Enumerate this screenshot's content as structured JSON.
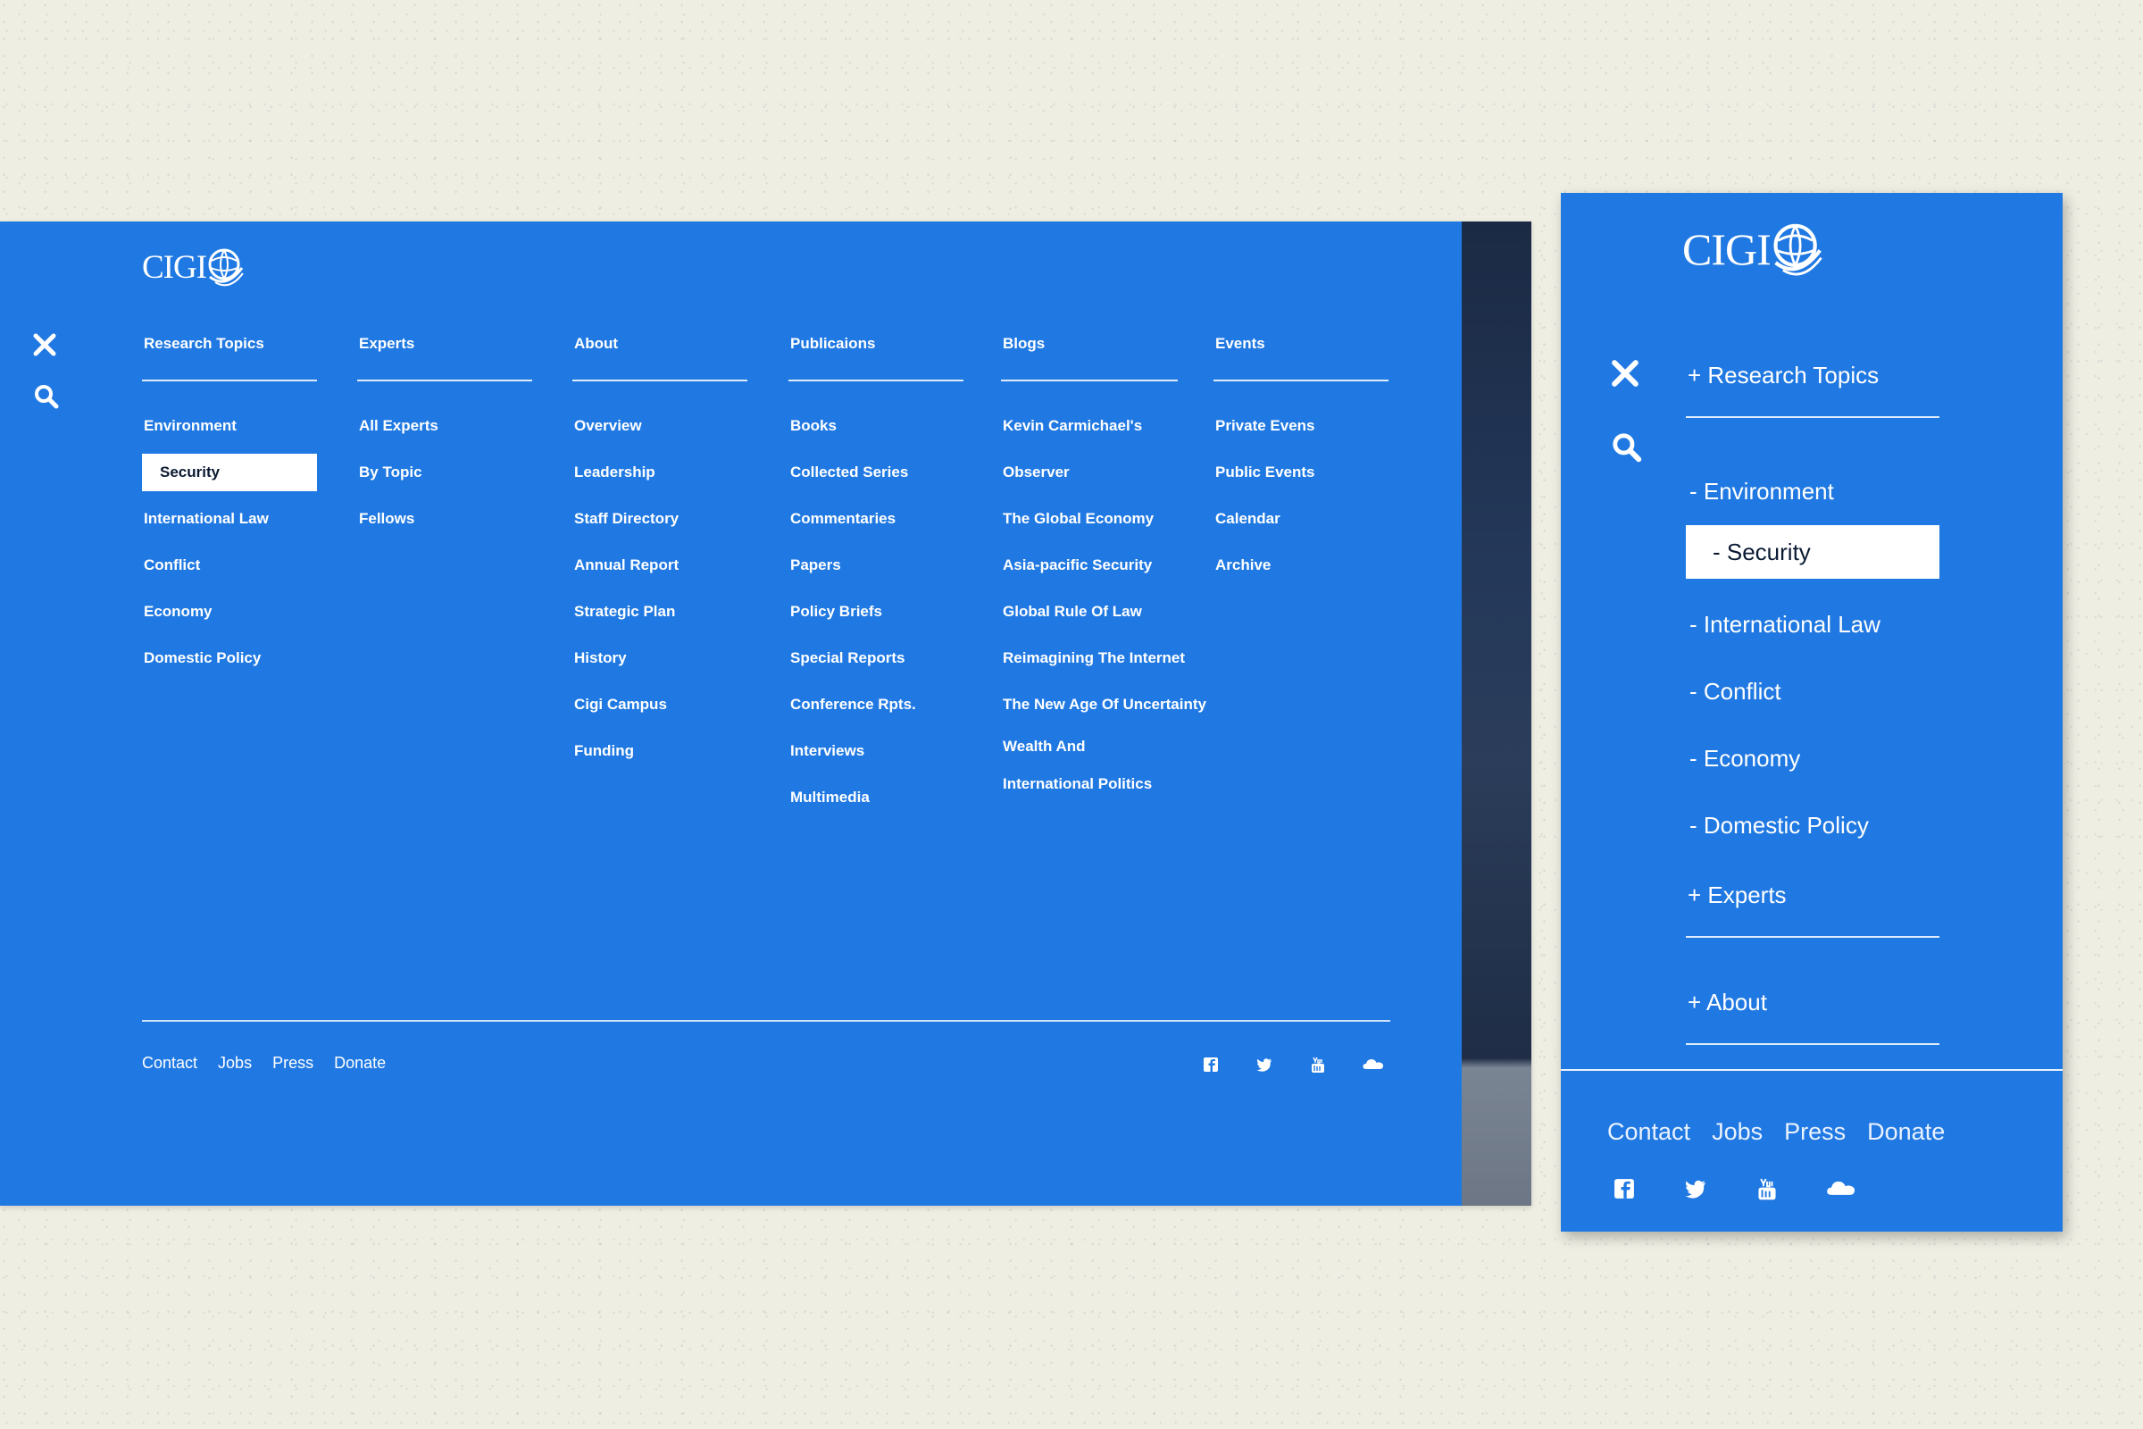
{
  "brand": {
    "logo_text": "CIGI"
  },
  "desktop": {
    "columns": [
      {
        "title": "Research Topics",
        "items": [
          "Environment",
          "Security",
          "International Law",
          "Conflict",
          "Economy",
          "Domestic Policy"
        ],
        "active": "Security"
      },
      {
        "title": "Experts",
        "items": [
          "All Experts",
          "By Topic",
          "Fellows"
        ]
      },
      {
        "title": "About",
        "items": [
          "Overview",
          "Leadership",
          "Staff Directory",
          "Annual Report",
          "Strategic Plan",
          "History",
          "Cigi Campus",
          "Funding"
        ]
      },
      {
        "title": "Publicaions",
        "items": [
          "Books",
          "Collected Series",
          "Commentaries",
          "Papers",
          "Policy Briefs",
          "Special Reports",
          "Conference Rpts.",
          "Interviews",
          "Multimedia"
        ]
      },
      {
        "title": "Blogs",
        "items": [
          "Kevin Carmichael's",
          "Observer",
          "The Global Economy",
          "Asia-pacific Security",
          "Global Rule Of Law",
          "Reimagining The Internet",
          "The New Age Of Uncertainty",
          "Wealth And International Politics"
        ]
      },
      {
        "title": "Events",
        "items": [
          "Private Evens",
          "Public Events",
          "Calendar",
          "Archive"
        ]
      }
    ],
    "footer_links": [
      "Contact",
      "Jobs",
      "Press",
      "Donate"
    ],
    "social_icons": [
      "facebook-icon",
      "twitter-icon",
      "youtube-icon",
      "soundcloud-icon"
    ]
  },
  "mobile": {
    "research_topics": "+ Research Topics",
    "topics": [
      "- Environment",
      "- Security",
      "- International Law",
      "- Conflict",
      "- Economy",
      "- Domestic Policy"
    ],
    "active": "- Security",
    "experts": "+ Experts",
    "about": "+ About",
    "footer_links": [
      "Contact",
      "Jobs",
      "Press",
      "Donate"
    ],
    "social_icons": [
      "facebook-icon",
      "twitter-icon",
      "youtube-icon",
      "soundcloud-icon"
    ]
  },
  "colors": {
    "primary": "#2079e2",
    "active_bg": "#ffffff",
    "active_text": "#0b1a33",
    "page_bg": "#efeee3"
  }
}
